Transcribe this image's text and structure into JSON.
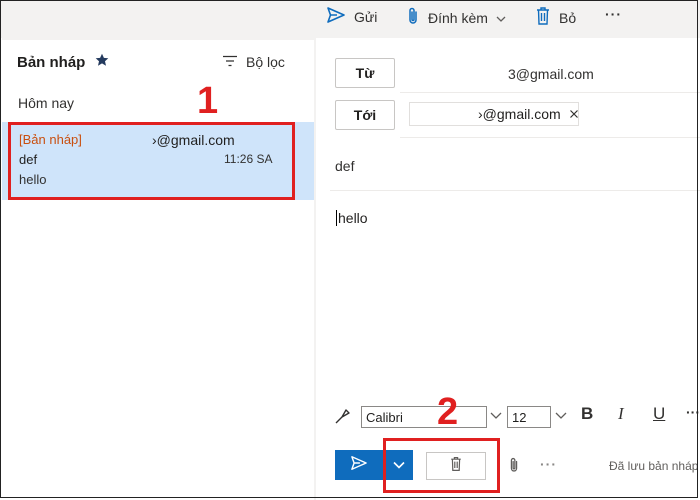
{
  "toolbar": {
    "send_label": "Gửi",
    "attach_label": "Đính kèm",
    "discard_label": "Bỏ",
    "more_label": "···"
  },
  "message_list": {
    "folder_title": "Bản nháp",
    "filter_label": "Bộ lọc",
    "group_label": "Hôm nay",
    "items": [
      {
        "status": "[Bản nháp]",
        "from": "›@gmail.com",
        "subject": "def",
        "time": "11:26 SA",
        "preview": "hello"
      }
    ]
  },
  "compose": {
    "from_button": "Từ",
    "from_value": "3@gmail.com",
    "to_button": "Tới",
    "to_chip": "›@gmail.com",
    "subject": "def",
    "body": "hello"
  },
  "format_bar": {
    "font": "Calibri",
    "size": "12",
    "bold": "B",
    "italic": "I",
    "underline": "U",
    "more": "···"
  },
  "footer": {
    "more_label": "···",
    "saved_status": "Đã lưu bản nháp"
  },
  "annotations": {
    "step1": "1",
    "step2": "2"
  },
  "colors": {
    "accent": "#0f6cbd",
    "selected_bg": "#cfe4fa",
    "draft_tag": "#c94f0f",
    "annotation_red": "#e02020"
  }
}
